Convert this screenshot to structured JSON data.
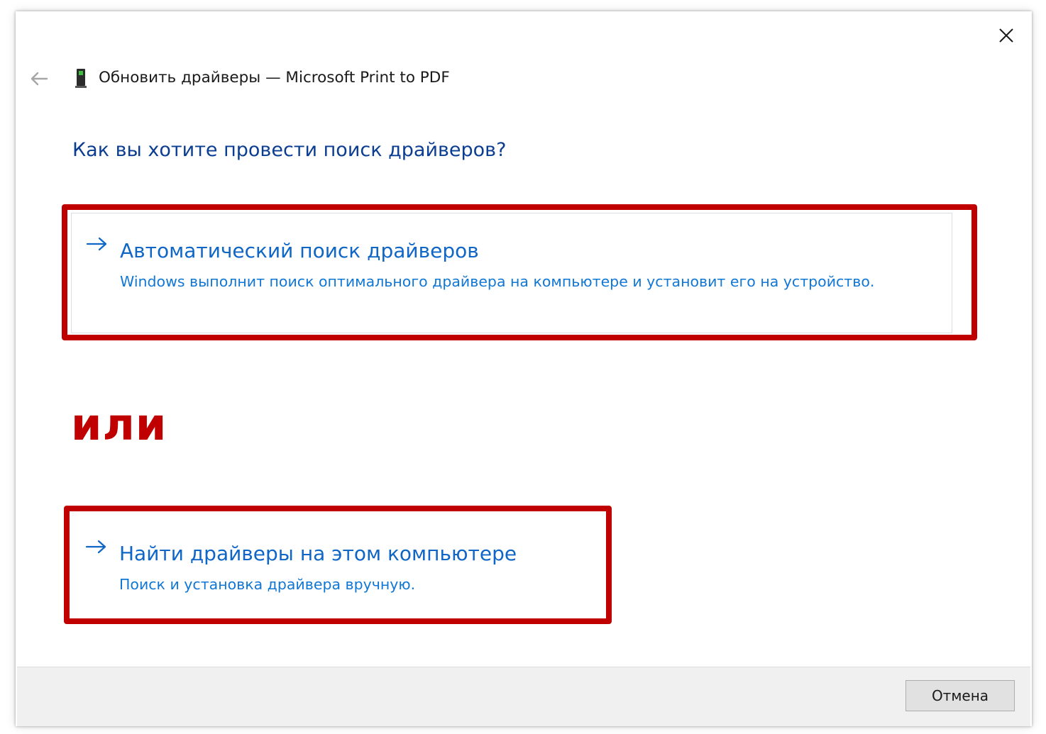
{
  "window": {
    "title": "Обновить драйверы — Microsoft Print to PDF"
  },
  "icons": {
    "close": "close-icon",
    "back": "back-arrow-icon",
    "device": "printer-device-icon",
    "option_arrow": "arrow-right-icon"
  },
  "main": {
    "question": "Как вы хотите провести поиск драйверов?",
    "options": [
      {
        "title": "Автоматический поиск драйверов",
        "description": "Windows выполнит поиск оптимального драйвера на компьютере и установит его на устройство."
      },
      {
        "title": "Найти драйверы на этом компьютере",
        "description": "Поиск и установка драйвера вручную."
      }
    ],
    "or_label": "или"
  },
  "footer": {
    "cancel_label": "Отмена"
  },
  "colors": {
    "heading": "#0b3d91",
    "link": "#0f66c6",
    "highlight": "#c00000",
    "footer_bg": "#f0f0f0"
  }
}
